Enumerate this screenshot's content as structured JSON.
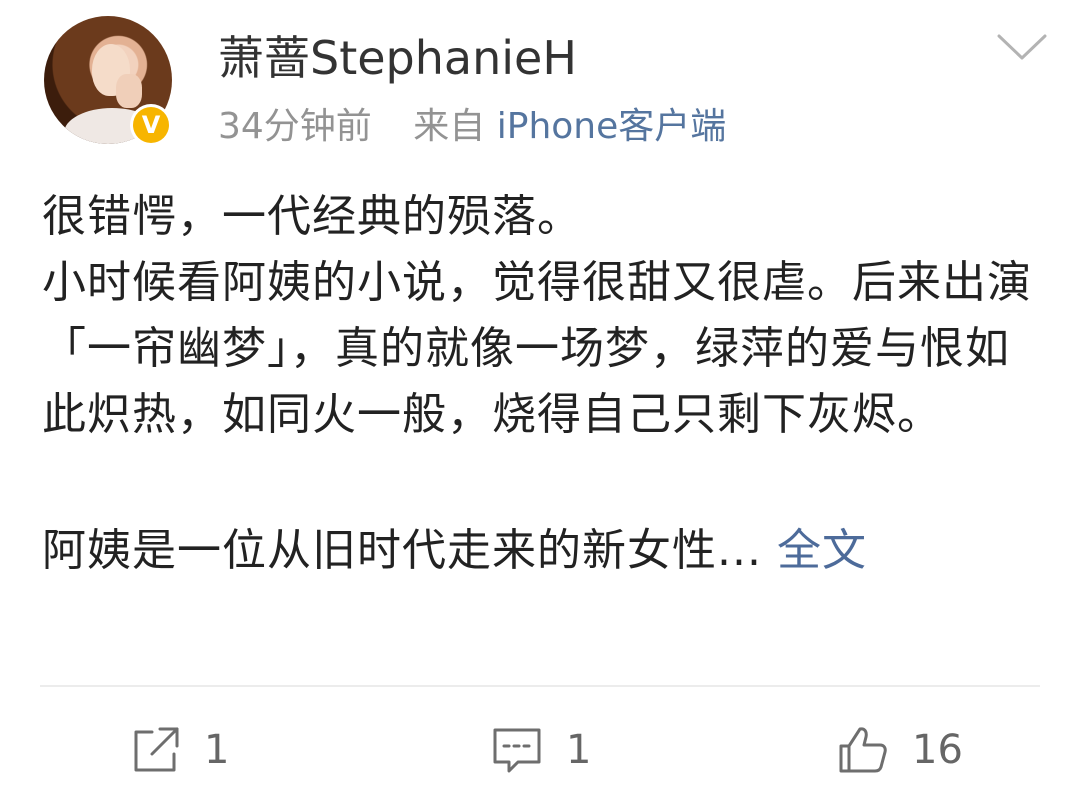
{
  "author": {
    "name": "萧蔷StephanieH",
    "verified_badge": "V"
  },
  "meta": {
    "time": "34分钟前",
    "source_prefix": "来自",
    "source": "iPhone客户端"
  },
  "content": {
    "paragraph_1": "很错愕，一代经典的殒落。",
    "paragraph_2": "小时候看阿姨的小说，觉得很甜又很虐。后来出演「一帘幽梦」，真的就像一场梦，绿萍的爱与恨如此炽热，如同火一般，烧得自己只剩下灰烬。",
    "paragraph_3": "阿姨是一位从旧时代走来的新女性...",
    "full_text_link": "全文"
  },
  "actions": {
    "repost": {
      "icon": "repost-icon",
      "count": "1"
    },
    "comment": {
      "icon": "comment-icon",
      "count": "1"
    },
    "like": {
      "icon": "thumbs-up-icon",
      "count": "16"
    }
  },
  "colors": {
    "link": "#4d6b9a",
    "meta_gray": "#939393",
    "badge": "#f7b500"
  }
}
